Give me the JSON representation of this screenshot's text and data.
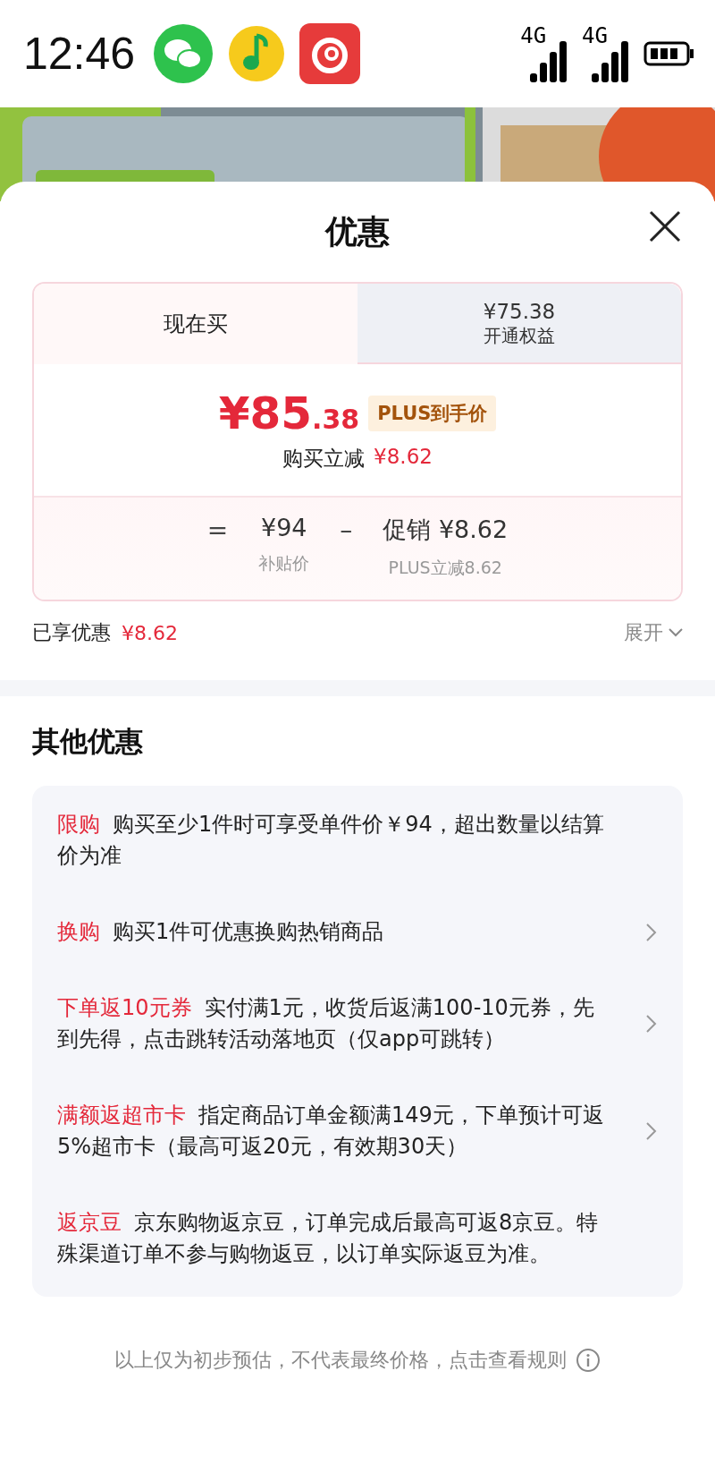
{
  "status_bar": {
    "time": "12:46",
    "signals": [
      {
        "label": "4G"
      },
      {
        "label": "4G"
      }
    ]
  },
  "sheet": {
    "title": "优惠",
    "price_card": {
      "tabs": [
        {
          "label": "现在买",
          "selected": true
        },
        {
          "price": "¥75.38",
          "label": "开通权益",
          "selected": false
        }
      ],
      "price": {
        "currency": "¥",
        "integer": "85",
        "decimal": ".38"
      },
      "price_badge": "PLUS到手价",
      "saving_label": "购买立减",
      "saving_value": "¥8.62",
      "breakdown": {
        "equals": "=",
        "base_value": "¥94",
        "base_label": "补贴价",
        "minus": "–",
        "promo_label": "促销",
        "promo_value": "¥8.62",
        "promo_note": "PLUS立减8.62"
      }
    },
    "enjoyed": {
      "label": "已享优惠",
      "value": "¥8.62",
      "expand": "展开"
    },
    "other": {
      "title": "其他优惠",
      "offers": [
        {
          "tag": "限购",
          "text": "购买至少1件时可享受单件价￥94，超出数量以结算价为准",
          "arrow": false
        },
        {
          "tag": "换购",
          "text": "购买1件可优惠换购热销商品",
          "arrow": true
        },
        {
          "tag": "下单返10元券",
          "text": "实付满1元，收货后返满100-10元券，先到先得，点击跳转活动落地页（仅app可跳转）",
          "arrow": true
        },
        {
          "tag": "满额返超市卡",
          "text": "指定商品订单金额满149元，下单预计可返5%超市卡（最高可返20元，有效期30天）",
          "arrow": true
        },
        {
          "tag": "返京豆",
          "text": "京东购物返京豆，订单完成后最高可返8京豆。特殊渠道订单不参与购物返豆，以订单实际返豆为准。",
          "arrow": false
        }
      ]
    },
    "footer": "以上仅为初步预估，不代表最终价格，点击查看规则"
  }
}
